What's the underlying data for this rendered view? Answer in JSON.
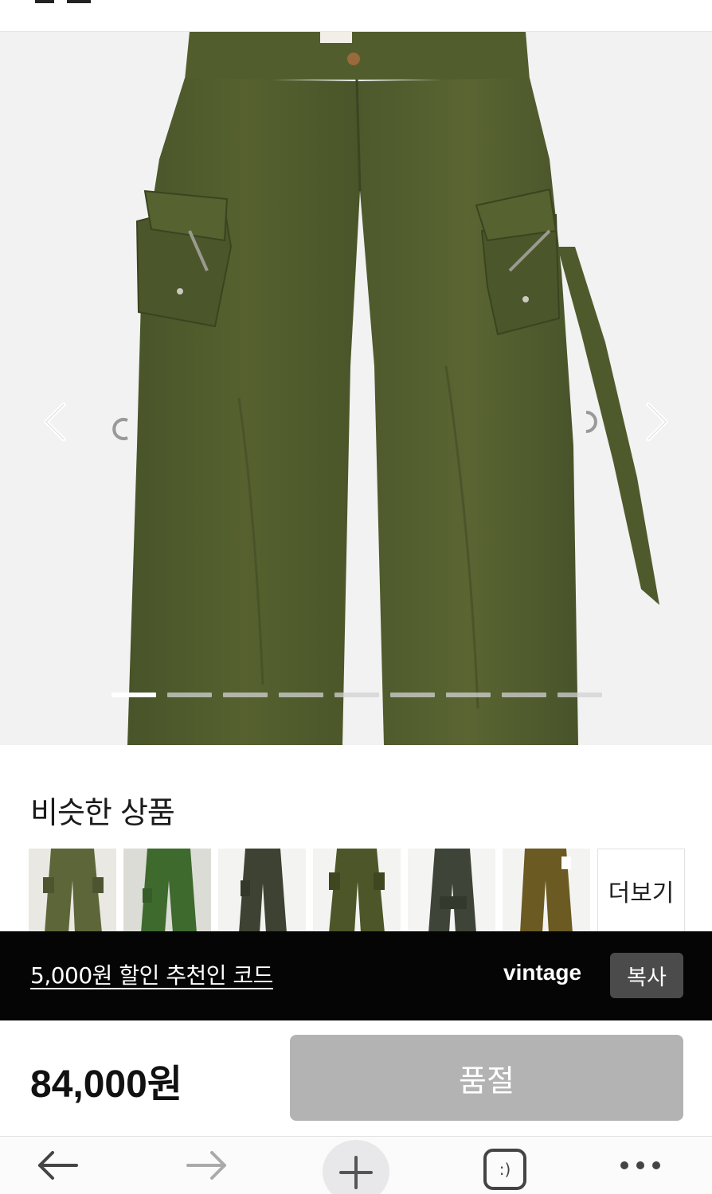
{
  "similar": {
    "title": "비슷한 상품",
    "more_label": "더보기"
  },
  "gallery": {
    "total_images": 9,
    "current_image": 1
  },
  "promo": {
    "text": "5,000원 할인 추천인 코드",
    "code": "vintage",
    "copy_label": "복사"
  },
  "purchase": {
    "price": "84,000원",
    "status_label": "품절"
  },
  "browser": {
    "tabs_icon_label": ":)"
  },
  "colors": {
    "olive": "#4f5a2e",
    "banner_bg": "#050505",
    "sold_out_bg": "#b3b3b3",
    "copy_bg": "#4b4b4b"
  }
}
